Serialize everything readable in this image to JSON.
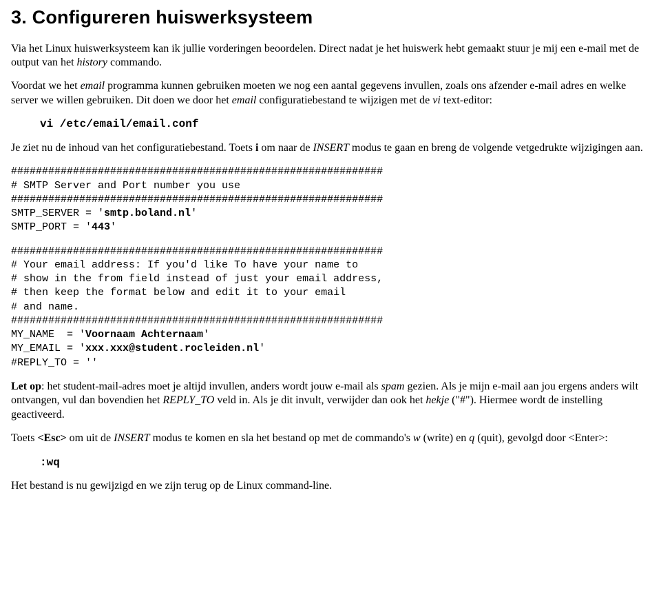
{
  "title": "3. Configureren huiswerksysteem",
  "p1a": "Via het Linux huiswerksysteem kan ik jullie vorderingen beoordelen. Direct nadat je het huiswerk hebt gemaakt stuur je mij een e-mail met de output van het ",
  "p1b": "history",
  "p1c": " commando.",
  "p2a": "Voordat we het ",
  "p2b": "email",
  "p2c": " programma kunnen gebruiken moeten we nog een aantal gegevens invullen, zoals ons afzender e-mail adres en welke server we willen gebruiken. Dit doen we door het ",
  "p2d": "email",
  "p2e": " configuratiebestand te wijzigen met de ",
  "p2f": "vi",
  "p2g": " text-editor:",
  "cmd1": "vi /etc/email/email.conf",
  "p3a": "Je ziet nu de inhoud van het configuratiebestand. Toets ",
  "p3b": "i",
  "p3c": " om naar de ",
  "p3d": "INSERT",
  "p3e": " modus te gaan en breng de volgende vetgedrukte wijzigingen aan.",
  "code1_l1": "############################################################",
  "code1_l2": "# SMTP Server and Port number you use",
  "code1_l3": "############################################################",
  "code1_l4a": "SMTP_SERVER = '",
  "code1_l4b": "smtp.boland.nl",
  "code1_l4c": "'",
  "code1_l5a": "SMTP_PORT = '",
  "code1_l5b": "443",
  "code1_l5c": "'",
  "code2_l1": "############################################################",
  "code2_l2": "# Your email address: If you'd like To have your name to",
  "code2_l3": "# show in the from field instead of just your email address,",
  "code2_l4": "# then keep the format below and edit it to your email",
  "code2_l5": "# and name.",
  "code2_l6": "############################################################",
  "code2_l7a": "MY_NAME  = '",
  "code2_l7b": "Voornaam Achternaam",
  "code2_l7c": "'",
  "code2_l8a": "MY_EMAIL = '",
  "code2_l8b": "xxx.xxx@student.rocleiden.nl",
  "code2_l8c": "'",
  "code2_l9": "#REPLY_TO = ''",
  "p4a": "Let op",
  "p4b": ": het student-mail-adres moet je altijd invullen, anders wordt jouw e-mail als ",
  "p4c": "spam",
  "p4d": " gezien. Als je mijn e-mail aan jou ergens anders wilt ontvangen, vul dan bovendien het ",
  "p4e": "REPLY_TO",
  "p4f": " veld in. Als je dit invult, verwijder dan ook het ",
  "p4g": "hekje",
  "p4h": " (\"#\"). Hiermee wordt de instelling geactiveerd.",
  "p5a": "Toets ",
  "p5b": "<Esc>",
  "p5c": " om uit de ",
  "p5d": "INSERT",
  "p5e": " modus te komen en sla het bestand op met de commando's ",
  "p5f": "w",
  "p5g": " (write) en ",
  "p5h": "q",
  "p5i": " (quit), gevolgd door <Enter>:",
  "cmd2": ":wq",
  "p6": "Het bestand is nu gewijzigd en we zijn terug op de Linux command-line."
}
